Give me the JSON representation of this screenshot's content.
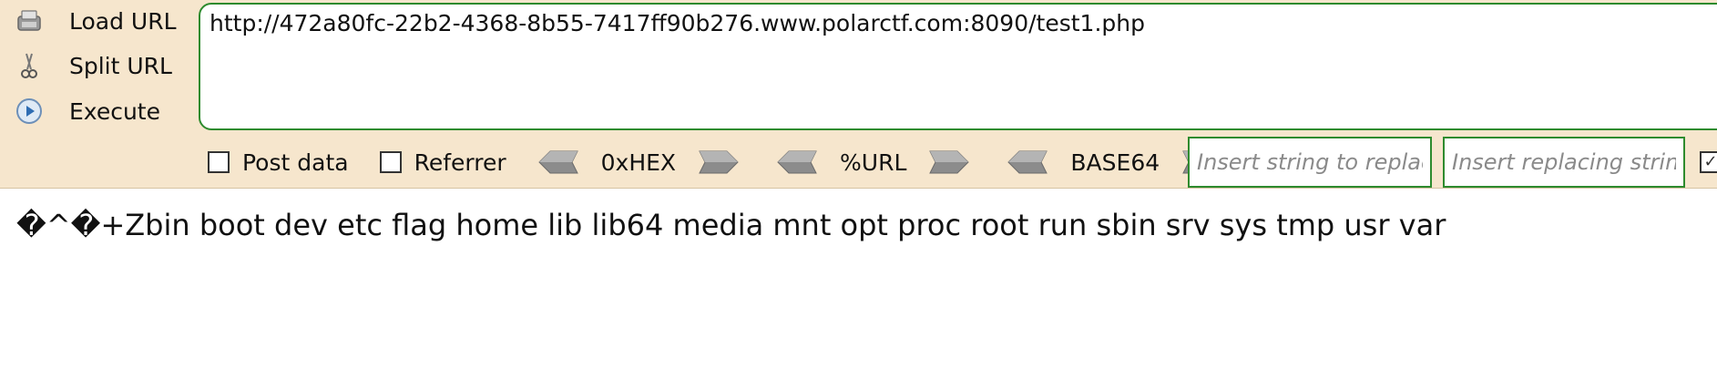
{
  "menu": {
    "load_url": "Load URL",
    "split_url": "Split URL",
    "execute": "Execute"
  },
  "url": {
    "value": "http://472a80fc-22b2-4368-8b55-7417ff90b276.www.polarctf.com:8090/test1.php"
  },
  "options": {
    "post_data": "Post data",
    "referrer": "Referrer",
    "hex": "0xHEX",
    "url_enc": "%URL",
    "base64": "BASE64"
  },
  "replace": {
    "find_placeholder": "Insert string to replace",
    "replace_placeholder": "Insert replacing string"
  },
  "output": {
    "text": "�^�+Zbin boot dev etc flag home lib lib64 media mnt opt proc root run sbin srv sys tmp usr var"
  },
  "colors": {
    "toolbar_bg": "#f6e6cd",
    "accent_green": "#2e8b2e"
  }
}
